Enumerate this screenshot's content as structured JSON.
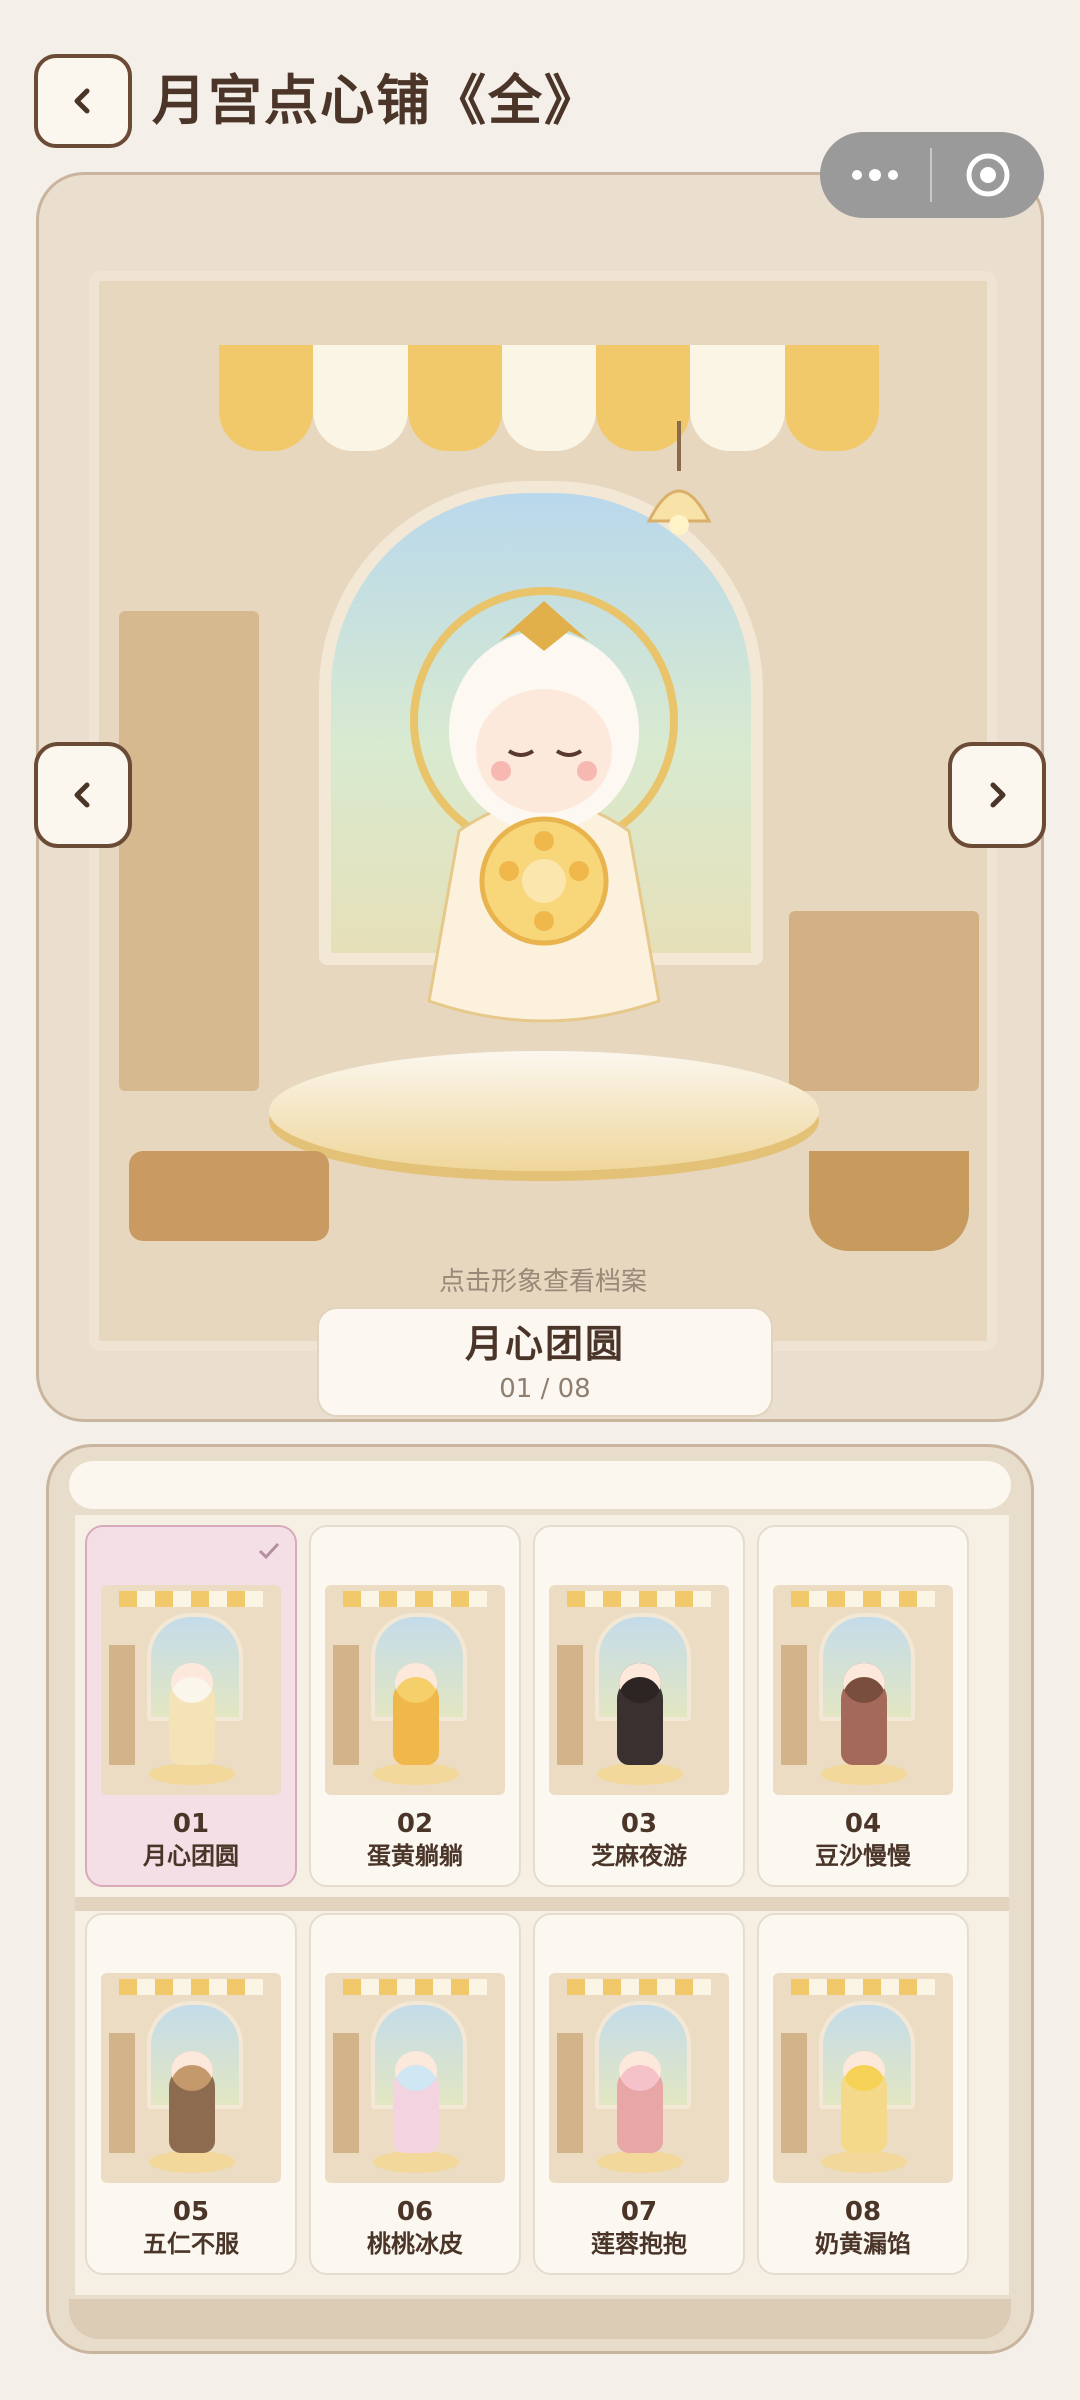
{
  "header": {
    "title": "月宫点心铺《全》"
  },
  "capsule": {
    "more_icon": "more-dots-icon",
    "close_icon": "target-close-icon"
  },
  "showcase": {
    "hint": "点击形象查看档案",
    "current_name": "月心团圆",
    "index_label": "01 / 08"
  },
  "colors": {
    "accent": "#f2c96a",
    "border_brown": "#6b4a36",
    "selected_bg": "#f5dfe6"
  },
  "collection": [
    {
      "num": "01",
      "name": "月心团圆",
      "selected": true,
      "body": "#f4e3b6",
      "hair": "#fbf6ec"
    },
    {
      "num": "02",
      "name": "蛋黄躺躺",
      "selected": false,
      "body": "#f0b84a",
      "hair": "#f5cf6a"
    },
    {
      "num": "03",
      "name": "芝麻夜游",
      "selected": false,
      "body": "#3b3030",
      "hair": "#2d2424"
    },
    {
      "num": "04",
      "name": "豆沙慢慢",
      "selected": false,
      "body": "#a4695a",
      "hair": "#7a4e3e"
    },
    {
      "num": "05",
      "name": "五仁不服",
      "selected": false,
      "body": "#8c6b4e",
      "hair": "#c49a6c"
    },
    {
      "num": "06",
      "name": "桃桃冰皮",
      "selected": false,
      "body": "#f3d3e0",
      "hair": "#cfe6f3"
    },
    {
      "num": "07",
      "name": "莲蓉抱抱",
      "selected": false,
      "body": "#e8a6a6",
      "hair": "#f4c2c8"
    },
    {
      "num": "08",
      "name": "奶黄漏馅",
      "selected": false,
      "body": "#f4d98a",
      "hair": "#f6d357"
    }
  ]
}
